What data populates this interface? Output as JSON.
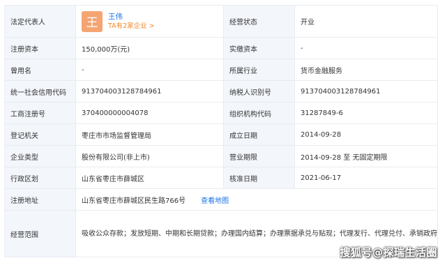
{
  "rows": {
    "legal_rep": {
      "label": "法定代表人",
      "avatar_char": "王",
      "name": "王伟",
      "sub": "TA有2家企业 >"
    },
    "status": {
      "label": "经营状态",
      "value": "开业"
    },
    "reg_capital": {
      "label": "注册资本",
      "value": "150,000万(元)"
    },
    "paid_capital": {
      "label": "实缴资本",
      "value": "-"
    },
    "former_name": {
      "label": "曾用名",
      "value": "-"
    },
    "industry": {
      "label": "所属行业",
      "value": "货币金融服务"
    },
    "credit_code": {
      "label": "统一社会信用代码",
      "value": "913704003128784961"
    },
    "taxpayer_id": {
      "label": "纳税人识别号",
      "value": "913704003128784961"
    },
    "biz_reg_no": {
      "label": "工商注册号",
      "value": "370400000004078"
    },
    "org_code": {
      "label": "组织机构代码",
      "value": "31287849-6"
    },
    "reg_authority": {
      "label": "登记机关",
      "value": "枣庄市市场监督管理局"
    },
    "founded": {
      "label": "成立日期",
      "value": "2014-09-28"
    },
    "company_type": {
      "label": "企业类型",
      "value": "股份有限公司(非上市)"
    },
    "biz_term": {
      "label": "营业期限",
      "value": "2014-09-28 至 无固定期限"
    },
    "region": {
      "label": "行政区划",
      "value": "山东省枣庄市薛城区"
    },
    "approval_date": {
      "label": "核准日期",
      "value": "2021-06-17"
    },
    "address": {
      "label": "注册地址",
      "value": "山东省枣庄市薛城区民生路766号",
      "link": "查看地图"
    },
    "scope": {
      "label": "经营范围",
      "value": "吸收公众存款；发放短期、中期和长期贷款；办理国内结算；办理票据承兑与贴现；代理发行、代理兑付、承销政府债券；买卖政府债券、金融债券；从事同业拆借；从事银行卡业务（借记卡）；代理收付款项；提供保管箱服务；经中国银行业监督管理委员会批准的其他业务。"
    }
  },
  "watermark": "搜狐号@探瑞生活圈"
}
